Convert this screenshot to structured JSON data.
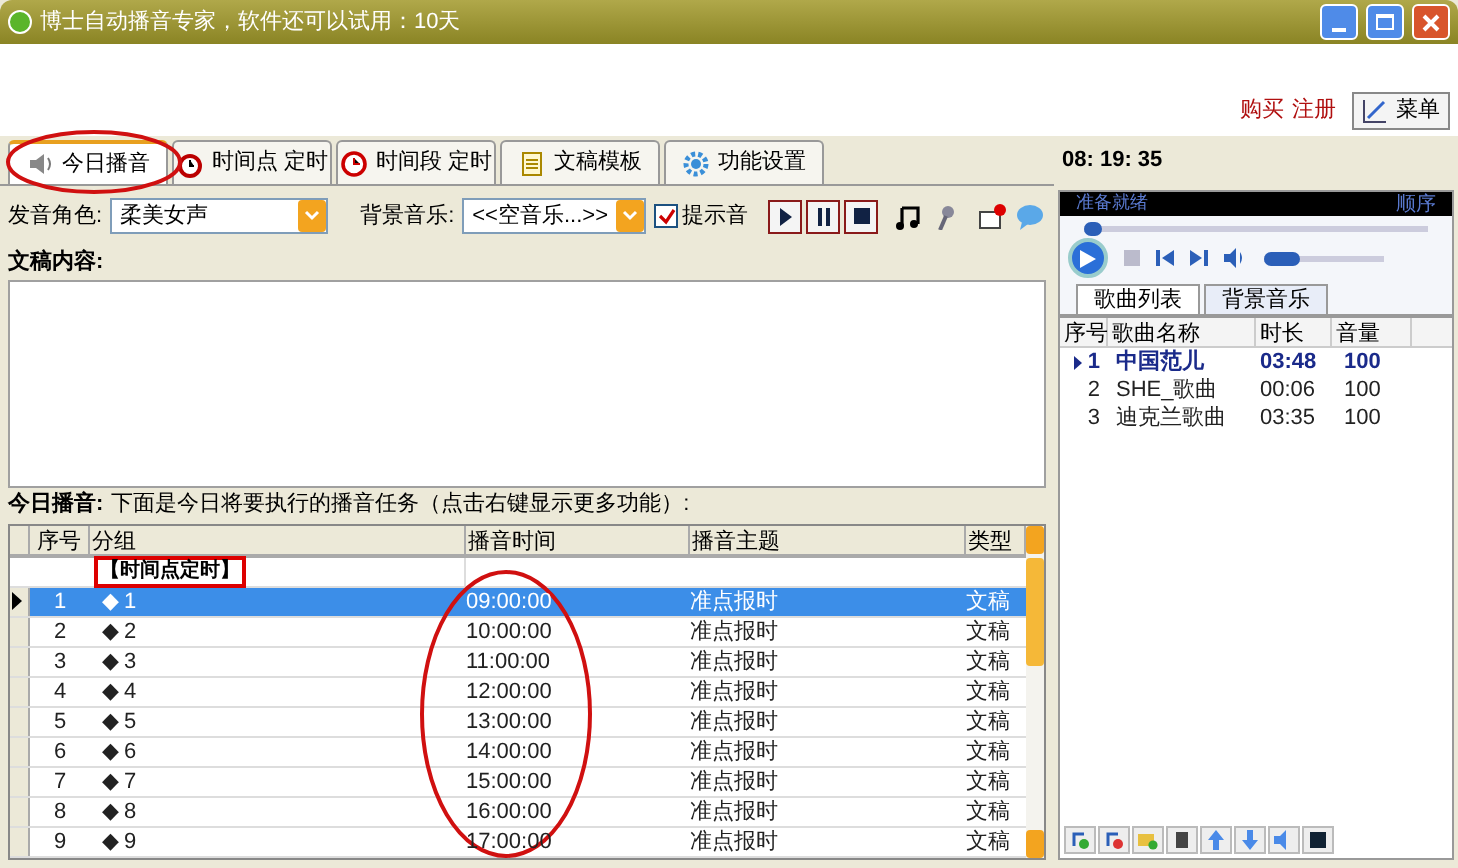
{
  "window": {
    "title": "博士自动播音专家，软件还可以试用：10天"
  },
  "header": {
    "links": [
      "购买",
      "注册"
    ],
    "menu_button": "菜单"
  },
  "tabs": [
    {
      "label": "今日播音",
      "selected": true,
      "kind": "speaker"
    },
    {
      "label": "时间点 定时",
      "selected": false,
      "kind": "alarm"
    },
    {
      "label": "时间段 定时",
      "selected": false,
      "kind": "clock"
    },
    {
      "label": "文稿模板",
      "selected": false,
      "kind": "document"
    },
    {
      "label": "功能设置",
      "selected": false,
      "kind": "gear"
    }
  ],
  "clock": "08: 19: 35",
  "controls": {
    "voice_label": "发音角色:",
    "voice_value": "柔美女声",
    "music_label": "背景音乐:",
    "music_value": "<<空音乐...>>",
    "prompt": {
      "label": "提示音",
      "checked": true
    }
  },
  "content_label": "文稿内容:",
  "today": {
    "label": "今日播音:",
    "description": "下面是今日将要执行的播音任务（点击右键显示更多功能）:"
  },
  "table": {
    "columns": [
      "序号",
      "分组",
      "播音时间",
      "播音主题",
      "类型"
    ],
    "group": "【时间点定时】",
    "rows": [
      {
        "index": "1",
        "group": "◆ 1",
        "time": "09:00:00",
        "topic": "准点报时",
        "type": "文稿",
        "selected": true
      },
      {
        "index": "2",
        "group": "◆ 2",
        "time": "10:00:00",
        "topic": "准点报时",
        "type": "文稿",
        "selected": false
      },
      {
        "index": "3",
        "group": "◆ 3",
        "time": "11:00:00",
        "topic": "准点报时",
        "type": "文稿",
        "selected": false
      },
      {
        "index": "4",
        "group": "◆ 4",
        "time": "12:00:00",
        "topic": "准点报时",
        "type": "文稿",
        "selected": false
      },
      {
        "index": "5",
        "group": "◆ 5",
        "time": "13:00:00",
        "topic": "准点报时",
        "type": "文稿",
        "selected": false
      },
      {
        "index": "6",
        "group": "◆ 6",
        "time": "14:00:00",
        "topic": "准点报时",
        "type": "文稿",
        "selected": false
      },
      {
        "index": "7",
        "group": "◆ 7",
        "time": "15:00:00",
        "topic": "准点报时",
        "type": "文稿",
        "selected": false
      },
      {
        "index": "8",
        "group": "◆ 8",
        "time": "16:00:00",
        "topic": "准点报时",
        "type": "文稿",
        "selected": false
      },
      {
        "index": "9",
        "group": "◆ 9",
        "time": "17:00:00",
        "topic": "准点报时",
        "type": "文稿",
        "selected": false
      }
    ]
  },
  "player": {
    "status": "准备就绪",
    "mode": "顺序",
    "progress": {
      "level": 0.04
    },
    "volume": {
      "level": 0.3
    },
    "tabs": [
      {
        "label": "歌曲列表",
        "selected": true
      },
      {
        "label": "背景音乐",
        "selected": false
      }
    ],
    "columns": [
      "序号",
      "歌曲名称",
      "时长",
      "音量"
    ],
    "songs": [
      {
        "index": "1",
        "name": "中国范儿",
        "duration": "03:48",
        "volume": "100",
        "playing": true
      },
      {
        "index": "2",
        "name": "SHE_歌曲",
        "duration": "00:06",
        "volume": "100",
        "playing": false
      },
      {
        "index": "3",
        "name": "迪克兰歌曲",
        "duration": "03:35",
        "volume": "100",
        "playing": false
      }
    ]
  }
}
